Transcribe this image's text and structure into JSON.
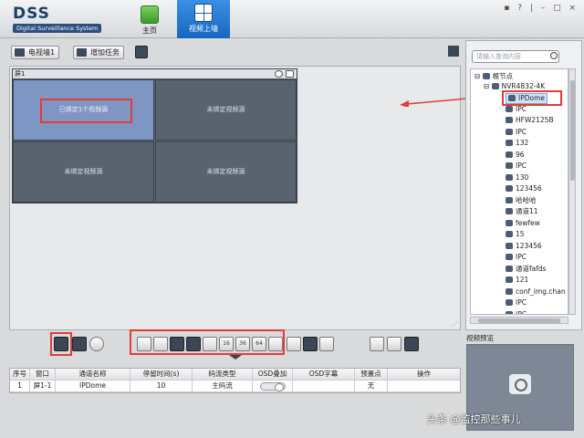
{
  "app": {
    "logo": "DSS",
    "logo_subtitle": "Digital Surveillance System",
    "nav": [
      {
        "label": "主页",
        "icon": "home-icon"
      },
      {
        "label": "视频上墙",
        "icon": "video-wall-icon"
      }
    ],
    "window_controls": "▪ ? | – □ ×"
  },
  "toolbar": {
    "tv_wall_label": "电视墙1",
    "add_task_label": "增加任务",
    "save_icon": "save-icon",
    "layout_icon": "layout-grid-icon"
  },
  "screen": {
    "title": "屏1",
    "cells": [
      {
        "text": "已绑定1个视频源",
        "active": true
      },
      {
        "text": "未绑定视频源",
        "active": false
      },
      {
        "text": "未绑定视频源",
        "active": false
      },
      {
        "text": "未绑定视频源",
        "active": false
      }
    ]
  },
  "split_buttons": [
    "1",
    "4",
    "9",
    "16",
    "25",
    "36",
    "64"
  ],
  "table": {
    "headers": [
      "序号",
      "窗口",
      "通道名称",
      "停留时间(s)",
      "码流类型",
      "OSD叠加",
      "OSD字幕",
      "预置点",
      "操作"
    ],
    "rows": [
      [
        "1",
        "屏1-1",
        "IPDome",
        "10",
        "主码流",
        "",
        "",
        "无",
        ""
      ]
    ]
  },
  "tree": {
    "search_placeholder": "请输入查询内容",
    "root": "根节点",
    "nvr": "NVR4832-4K",
    "channels": [
      "IPDome",
      "IPC",
      "HFW2125B",
      "IPC",
      "132",
      "96",
      "IPC",
      "130",
      "123456",
      "哈哈哈",
      "通道11",
      "fewfew",
      "15",
      "123456",
      "IPC",
      "通道fafds",
      "121",
      "conf_img.chan",
      "IPC",
      "IPC"
    ],
    "selected": "IPDome"
  },
  "preview": {
    "title": "视频预览"
  },
  "watermark": "头条 @监控那些事儿"
}
